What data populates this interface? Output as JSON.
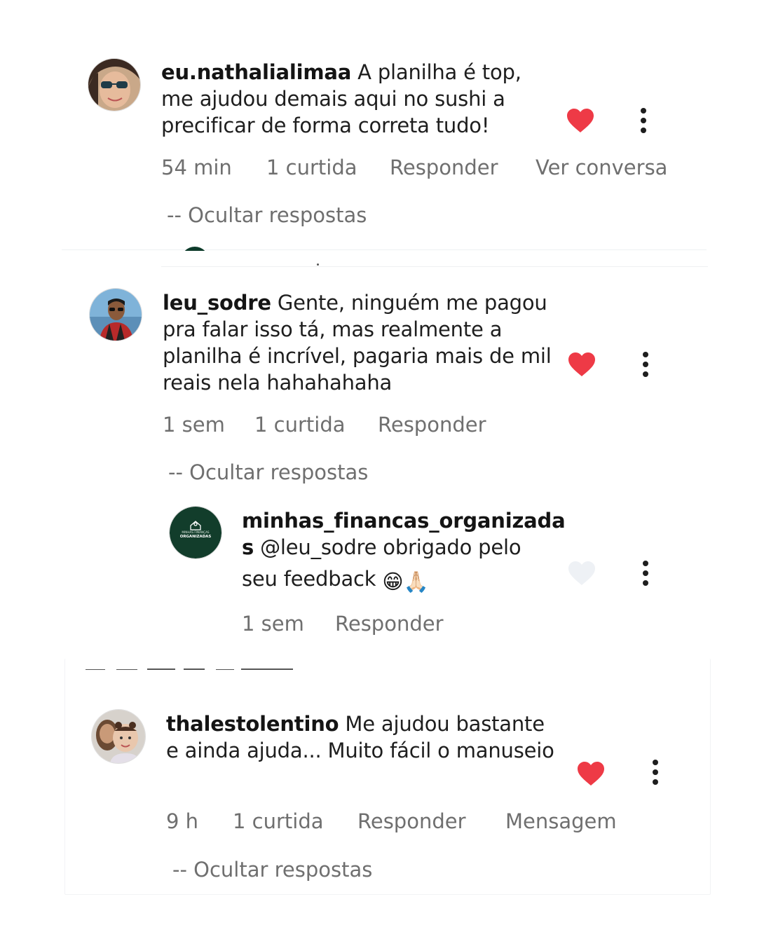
{
  "comments": [
    {
      "username": "eu.nathalialimaa",
      "text": "A planilha é top, me ajudou demais aqui no sushi a precificar de forma correta tudo!",
      "time": "54 min",
      "likes": "1 curtida",
      "reply_label": "Responder",
      "extra_label": "Ver conversa",
      "hide_replies": "-- Ocultar respostas",
      "liked": true
    },
    {
      "username": "leu_sodre",
      "text": "Gente, ninguém me pagou pra falar isso tá, mas realmente a planilha é incrível, pagaria mais de mil reais nela hahahahaha",
      "time": "1 sem",
      "likes": "1 curtida",
      "reply_label": "Responder",
      "hide_replies": "-- Ocultar respostas",
      "liked": true
    },
    {
      "username": "thalestolentino",
      "text": "Me ajudou bastante e ainda ajuda... Muito fácil o manuseio",
      "time": "9 h",
      "likes": "1 curtida",
      "reply_label": "Responder",
      "extra_label": "Mensagem",
      "hide_replies": "-- Ocultar respostas",
      "liked": true
    }
  ],
  "reply": {
    "username_line1": "minhas_financas_organizada",
    "username_line2": "s",
    "mention": "@leu_sodre",
    "text_rest": "obrigado pelo",
    "text_line3": "seu feedback",
    "emojis": "😁🙏🏻",
    "time": "1 sem",
    "reply_label": "Responder",
    "liked": false,
    "avatar_text_top": "MINHAS FINANÇAS",
    "avatar_text_bottom": "ORGANIZADAS"
  },
  "colors": {
    "heart_liked": "#ee3a46",
    "heart_unliked": "#eef1f5",
    "meta_text": "#6f6f6f",
    "brand_green": "#123d2b"
  },
  "icons": [
    "heart-icon",
    "more-options-icon"
  ]
}
